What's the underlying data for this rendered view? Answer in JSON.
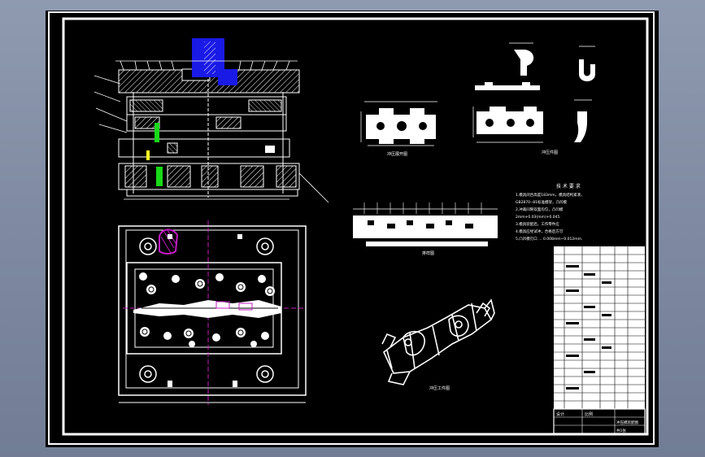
{
  "drawing": {
    "views": {
      "unfold_view_caption": "冲压展开图",
      "part_view_caption": "冲压件图",
      "strip_layout_caption": "排样图",
      "part_3d_caption": "冲压工件图"
    },
    "tech_requirements": {
      "heading": "技 术 要 求",
      "lines": [
        "1.模具闭合高度183mm，模具结构紧凑，",
        "GB2870--81标准模架，凸凹模",
        "2.冲裁间隙双面均匀，凸凹模",
        "2mm+0.03(mm)+0.045.",
        "3.模具装配后，工作零件应",
        "4.模具应经试冲，合格后方可",
        "5.凸凹模刃口 ... 0.008mm~0.012mm."
      ]
    },
    "title_block": {
      "designer_label": "设计",
      "scale_label": "比例",
      "drawing_name": "冲压模装配图",
      "sheet_label": "共1张"
    },
    "colors": {
      "paper": "#000000",
      "line": "#ffffff",
      "punch": "#1a1ae6",
      "guide": "#c21cc2",
      "insert": "#19d919",
      "frame_bg": "#7f8aa2"
    }
  }
}
